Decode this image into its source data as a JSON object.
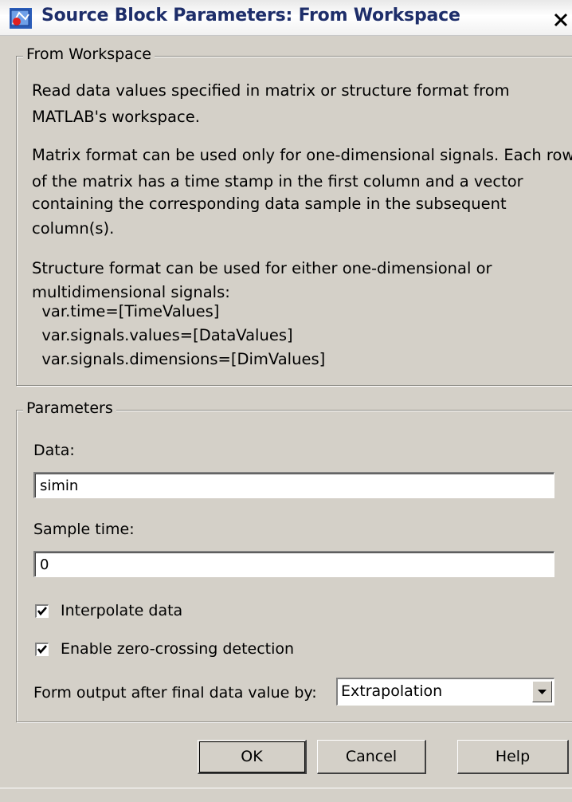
{
  "window": {
    "title": "Source Block Parameters: From Workspace",
    "close_glyph": "X",
    "title_icon": "simulink-block-icon"
  },
  "description_group": {
    "legend": "From Workspace",
    "lines": [
      "Read data values specified in matrix or structure format from",
      "MATLAB's workspace.",
      "Matrix format can be used only for one-dimensional signals. Each row",
      "of the matrix has a time stamp in the first column and a vector",
      "containing the corresponding data sample in the subsequent",
      "column(s).",
      "Structure format can be used for either one-dimensional or",
      "multidimensional signals:",
      "  var.time=[TimeValues]",
      "  var.signals.values=[DataValues]",
      "  var.signals.dimensions=[DimValues]"
    ]
  },
  "parameters_group": {
    "legend": "Parameters",
    "data_label": "Data:",
    "data_value": "simin",
    "sample_time_label": "Sample time:",
    "sample_time_value": "0",
    "interpolate_label": "Interpolate data",
    "interpolate_checked": true,
    "zero_crossing_label": "Enable zero-crossing detection",
    "zero_crossing_checked": true,
    "form_output_label": "Form output after final data value by:",
    "form_output_value": "Extrapolation"
  },
  "buttons": {
    "ok": "OK",
    "cancel": "Cancel",
    "help": "Help"
  }
}
